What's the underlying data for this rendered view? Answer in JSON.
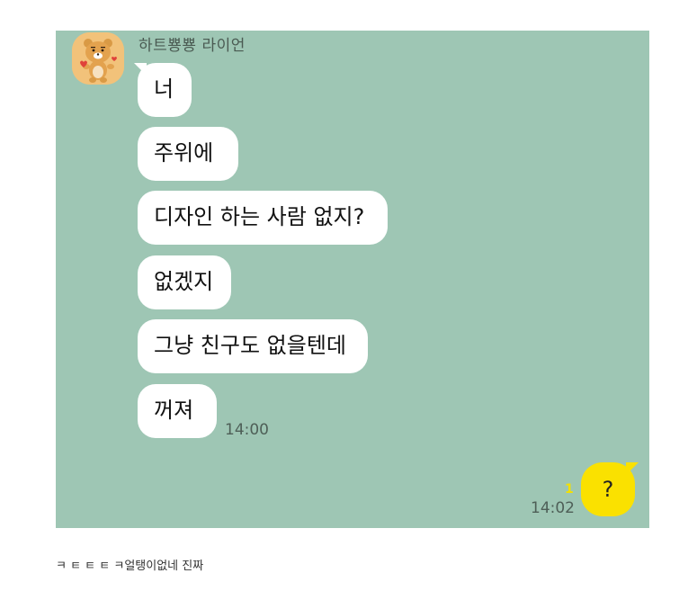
{
  "sender_name": "하트뿅뿅 라이언",
  "avatar_icon": "ryan-character-icon",
  "messages": [
    {
      "text": "너"
    },
    {
      "text": "주위에"
    },
    {
      "text": "디자인 하는 사람 없지?"
    },
    {
      "text": "없겠지"
    },
    {
      "text": "그냥 친구도 없을텐데"
    },
    {
      "text": "꺼져"
    }
  ],
  "received_time": "14:00",
  "sent": {
    "text": "?",
    "unread_count": "1",
    "time": "14:02"
  },
  "caption": "ㅋ ㅌ ㅌ ㅌ ㅋ얼탱이없네 진짜",
  "colors": {
    "chat_bg": "#9ec6b4",
    "incoming_bubble": "#ffffff",
    "outgoing_bubble": "#fae100",
    "unread": "#f4e000"
  }
}
